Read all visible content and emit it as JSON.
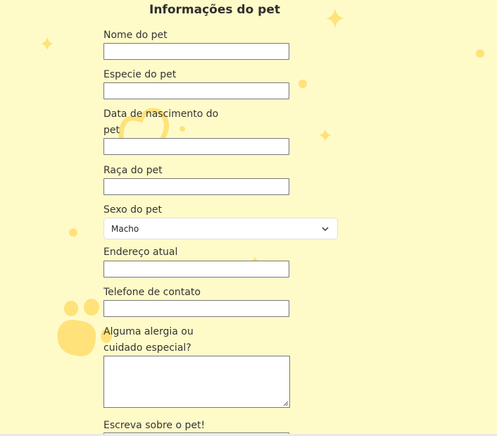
{
  "form": {
    "title": "Informações do pet",
    "name_label": "Nome do pet",
    "species_label": "Especie do pet",
    "birthdate_label": "Data de nascimento do pet",
    "breed_label": "Raça do pet",
    "sex_label": "Sexo do pet",
    "sex_selected": "Macho",
    "address_label": "Endereço atual",
    "phone_label": "Telefone de contato",
    "allergy_label": "Alguma alergia ou cuidado especial?",
    "about_label": "Escreva sobre o pet!"
  },
  "decor": {
    "accent_color": "#ffe27a",
    "icons": [
      "sparkle-icon",
      "paw-icon",
      "dot-icon"
    ]
  }
}
